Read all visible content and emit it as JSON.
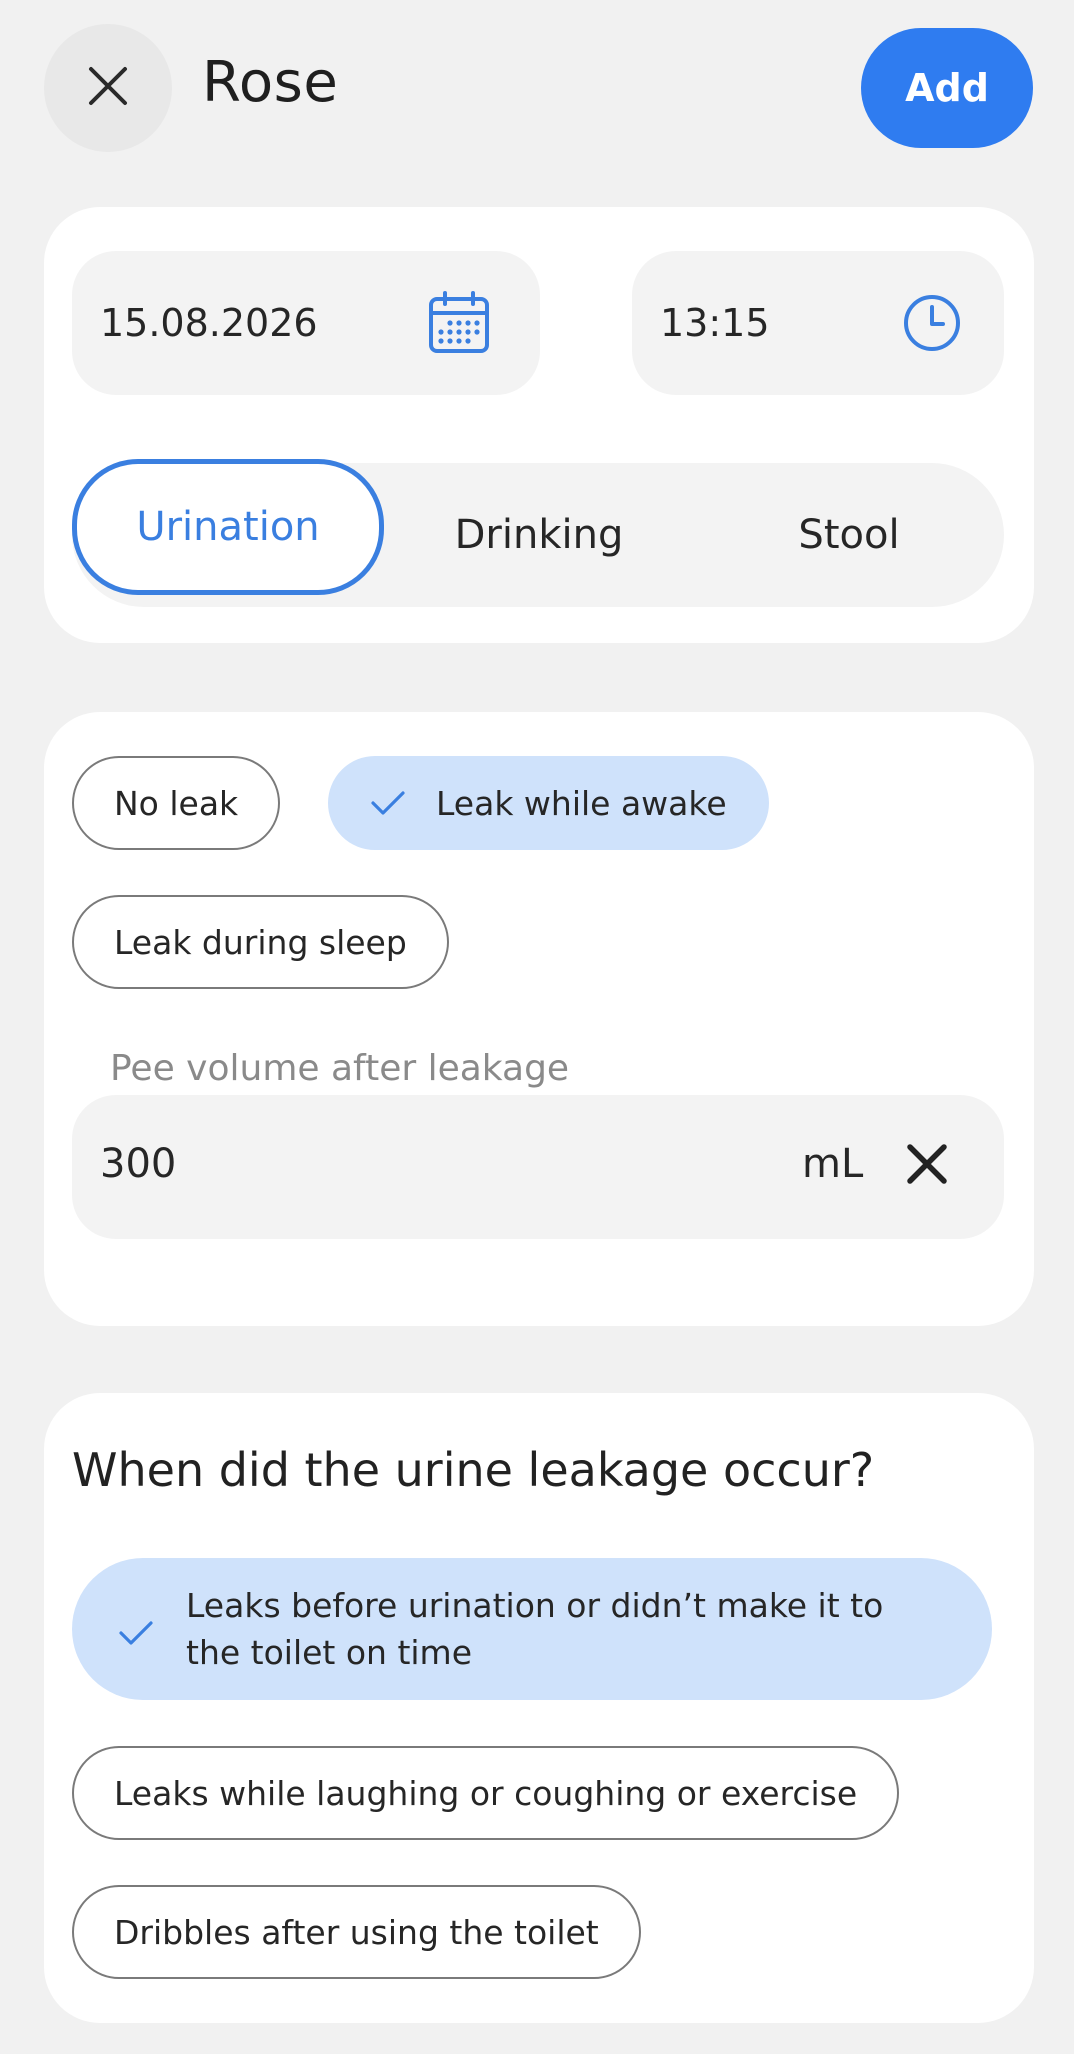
{
  "header": {
    "title": "Rose",
    "add_label": "Add"
  },
  "entry": {
    "date": "15.08.2026",
    "time": "13:15"
  },
  "tabs": [
    {
      "label": "Urination",
      "active": true
    },
    {
      "label": "Drinking",
      "active": false
    },
    {
      "label": "Stool",
      "active": false
    }
  ],
  "leak": {
    "options": [
      {
        "label": "No leak",
        "selected": false
      },
      {
        "label": "Leak while awake",
        "selected": true
      },
      {
        "label": "Leak during sleep",
        "selected": false
      }
    ],
    "volume_label": "Pee volume after leakage",
    "volume_value": "300",
    "volume_unit": "mL"
  },
  "occurrence": {
    "question": "When did the urine leakage occur?",
    "options": [
      {
        "label": "Leaks before urination or didn’t make it to the toilet on time",
        "selected": true
      },
      {
        "label": "Leaks while laughing or coughing or exercise",
        "selected": false
      },
      {
        "label": "Dribbles after using the toilet",
        "selected": false
      }
    ]
  },
  "colors": {
    "accent": "#2f7cf0",
    "selected_bg": "#cfe2fb",
    "background": "#f1f1f1",
    "card": "#ffffff"
  }
}
